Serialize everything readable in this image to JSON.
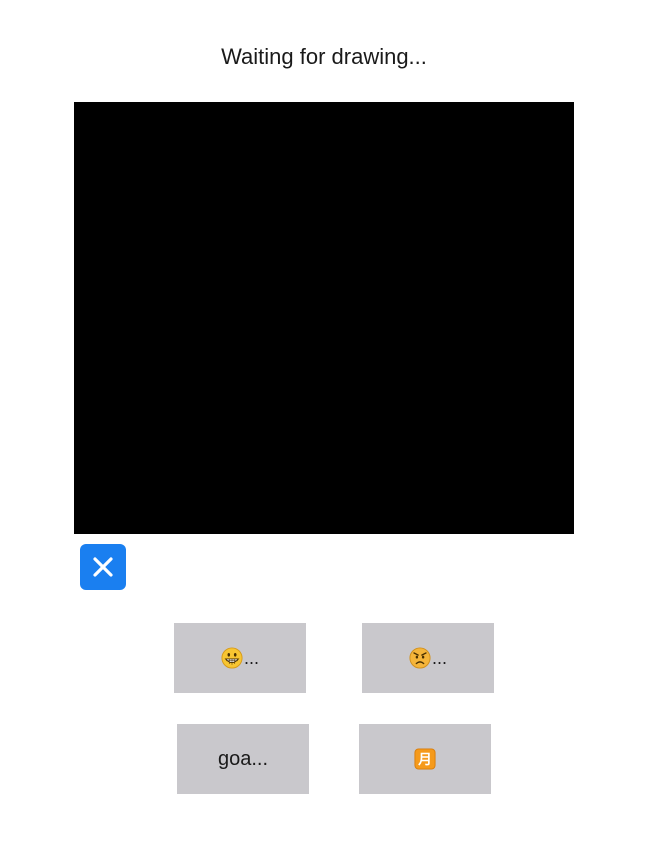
{
  "status": {
    "text": "Waiting for drawing..."
  },
  "canvas": {
    "background": "#000000"
  },
  "clear_button": {
    "icon": "close-icon",
    "color": "#1a7ff0"
  },
  "suggestions": {
    "button_color": "#c9c8cc",
    "items": [
      {
        "icon": "grinning-face-icon",
        "suffix": "..."
      },
      {
        "icon": "angry-face-icon",
        "suffix": "..."
      },
      {
        "text": "goa..."
      },
      {
        "icon": "japanese-monthly-amount-button-icon",
        "glyph": "月"
      }
    ]
  }
}
